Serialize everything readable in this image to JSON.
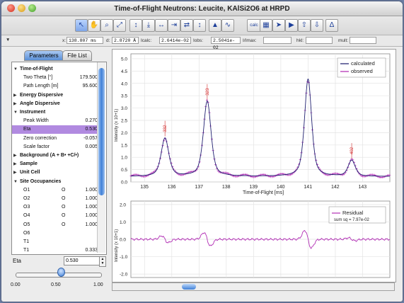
{
  "window": {
    "title": "Time-of-Flight Neutrons: Leucite, KAlSi2O6 at HRPD"
  },
  "toolbar": {
    "buttons": [
      {
        "name": "pointer-tool-icon",
        "glyph": "↖",
        "selected": true
      },
      {
        "name": "hand-tool-icon",
        "glyph": "✋",
        "selected": false
      },
      {
        "name": "zoom-tool-icon",
        "glyph": "⌕",
        "selected": false
      },
      {
        "name": "zoom-fit-icon",
        "glyph": "⤢",
        "selected": false
      },
      {
        "name": "expand-vertical-icon",
        "glyph": "↕",
        "selected": false
      },
      {
        "name": "compress-vertical-icon",
        "glyph": "⤓",
        "selected": false
      },
      {
        "name": "expand-horizontal-icon",
        "glyph": "↔",
        "selected": false
      },
      {
        "name": "compress-horizontal-icon",
        "glyph": "⇥",
        "selected": false
      },
      {
        "name": "shift-icon",
        "glyph": "⇄",
        "selected": false
      },
      {
        "name": "marker-icon",
        "glyph": "↕",
        "selected": false
      },
      {
        "name": "peak-icon",
        "glyph": "▲",
        "selected": false
      },
      {
        "name": "profile-icon",
        "glyph": "∿",
        "selected": false
      },
      {
        "name": "calculate-icon",
        "glyph": "c",
        "selected": false
      },
      {
        "name": "table-icon",
        "glyph": "▦",
        "selected": false
      },
      {
        "name": "next-icon",
        "glyph": "➤",
        "selected": false
      },
      {
        "name": "forward-icon",
        "glyph": "▶",
        "selected": false
      },
      {
        "name": "upload-icon",
        "glyph": "⇧",
        "selected": false
      },
      {
        "name": "download-icon",
        "glyph": "⇩",
        "selected": false
      },
      {
        "name": "delta-icon",
        "glyph": "Δ",
        "selected": false
      }
    ],
    "calc_label": "calc"
  },
  "infobar": {
    "collapse_glyph": "▼",
    "fields": [
      {
        "label": "x:",
        "value": "138.807 ms"
      },
      {
        "label": "d:",
        "value": "2.8720 Å"
      },
      {
        "label": "Icalc:",
        "value": "2.6414e-02"
      },
      {
        "label": "Iobs:",
        "value": "2.5041e-02"
      },
      {
        "label": "I/Imax:",
        "value": ""
      },
      {
        "label": "hkl:",
        "value": ""
      },
      {
        "label": "mult:",
        "value": ""
      }
    ]
  },
  "tabs": [
    {
      "label": "Parameters",
      "active": true
    },
    {
      "label": "File List",
      "active": false
    }
  ],
  "tree": [
    {
      "level": 0,
      "open": true,
      "label": "Time-of-Flight",
      "value": "",
      "bold": true
    },
    {
      "level": 1,
      "label": "Two Theta [°]",
      "value": "179.500"
    },
    {
      "level": 1,
      "label": "Path Length [m]",
      "value": "95.600"
    },
    {
      "level": 0,
      "open": false,
      "label": "Energy Dispersive",
      "value": "",
      "bold": true
    },
    {
      "level": 0,
      "open": false,
      "label": "Angle Dispersive",
      "value": "",
      "bold": true
    },
    {
      "level": 0,
      "open": true,
      "label": "Instrument",
      "value": "",
      "bold": true
    },
    {
      "level": 1,
      "label": "Peak Width",
      "value": "0.270"
    },
    {
      "level": 1,
      "label": "Eta",
      "value": "0.530",
      "selected": true
    },
    {
      "level": 1,
      "label": "Zero correction",
      "value": "-0.057"
    },
    {
      "level": 1,
      "label": "Scale factor",
      "value": "0.005"
    },
    {
      "level": 0,
      "open": false,
      "label": "Background (A + B• +C/•)",
      "value": "",
      "bold": true
    },
    {
      "level": 0,
      "open": false,
      "label": "Sample",
      "value": "",
      "bold": true
    },
    {
      "level": 0,
      "open": false,
      "label": "Unit Cell",
      "value": "",
      "bold": true
    },
    {
      "level": 0,
      "open": true,
      "label": "Site Occupancies",
      "value": "",
      "bold": true
    },
    {
      "level": 1,
      "label": "O1",
      "code": "O",
      "value": "1.000"
    },
    {
      "level": 1,
      "label": "O2",
      "code": "O",
      "value": "1.000"
    },
    {
      "level": 1,
      "label": "O3",
      "code": "O",
      "value": "1.000"
    },
    {
      "level": 1,
      "label": "O4",
      "code": "O",
      "value": "1.000"
    },
    {
      "level": 1,
      "label": "O5",
      "code": "O",
      "value": "1.000"
    },
    {
      "level": 1,
      "label": "O6",
      "code": "",
      "value": ""
    },
    {
      "level": 1,
      "label": "T1",
      "code": "",
      "value": ""
    },
    {
      "level": 1,
      "label": "T1",
      "code": "",
      "value": "0.333"
    }
  ],
  "eta_control": {
    "label": "Eta",
    "value": "0.530",
    "slider_value": 0.53,
    "slider_min": "0.00",
    "slider_mid": "0.50",
    "slider_max": "1.00"
  },
  "chart_data": [
    {
      "type": "line",
      "xlabel": "Time-of-Flight [ms]",
      "ylabel": "Intensity (x 10+1)",
      "xlim": [
        134.5,
        144.0
      ],
      "ylim": [
        0.0,
        5.2
      ],
      "xticks": [
        135,
        136,
        137,
        138,
        139,
        140,
        141,
        142,
        143
      ],
      "yticks": [
        0.0,
        0.5,
        1.0,
        1.5,
        2.0,
        2.5,
        3.0,
        3.5,
        4.0,
        4.5,
        5.0
      ],
      "grid": true,
      "legend_position": "top-right",
      "legend": [
        {
          "name": "calculated",
          "color": "#202070"
        },
        {
          "name": "observed",
          "color": "#b22eb5"
        }
      ],
      "peaks": [
        {
          "x": 135.75,
          "height": 1.55,
          "width": 0.14,
          "label": "332"
        },
        {
          "x": 137.3,
          "height": 3.05,
          "width": 0.14,
          "label": "323"
        },
        {
          "x": 141.0,
          "height": 3.95,
          "width": 0.13,
          "label": ""
        },
        {
          "x": 142.6,
          "height": 0.65,
          "width": 0.13,
          "label": "402"
        }
      ],
      "background": 0.22,
      "series": [
        {
          "name": "calculated",
          "color": "#202070",
          "style": "line"
        },
        {
          "name": "observed",
          "color": "#b22eb5",
          "style": "markers"
        }
      ]
    },
    {
      "type": "line",
      "xlabel": "",
      "ylabel": "Intensity (x 10+1)",
      "xlim": [
        134.5,
        144.0
      ],
      "ylim": [
        -2.2,
        2.2
      ],
      "yticks": [
        -2.0,
        -1.0,
        0.0,
        1.0,
        2.0
      ],
      "grid": true,
      "legend_position": "top-right",
      "legend": [
        {
          "name": "Residual",
          "color": "#b22eb5"
        }
      ],
      "annotation": "sum sq = 7.97e-02",
      "series": [
        {
          "name": "Residual",
          "color": "#b22eb5",
          "style": "line"
        }
      ]
    }
  ]
}
